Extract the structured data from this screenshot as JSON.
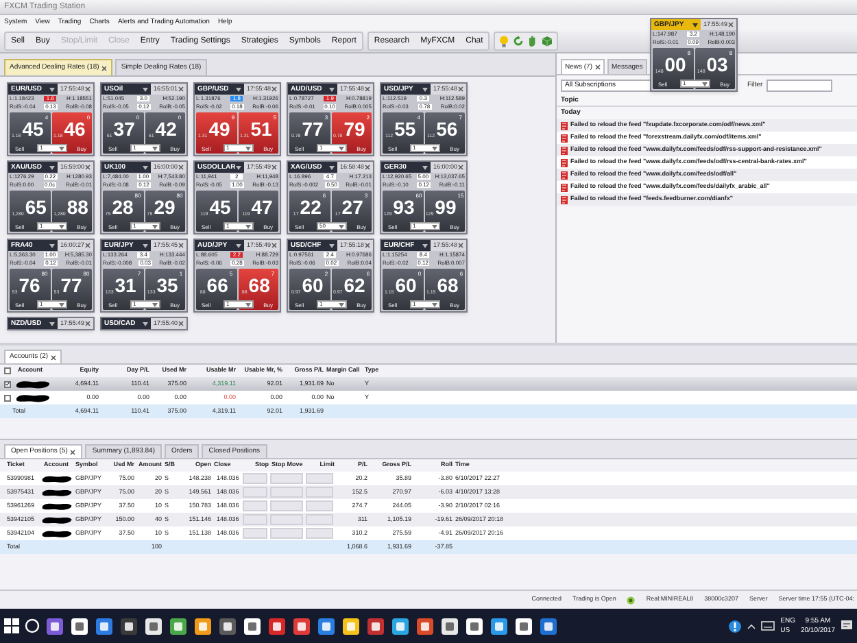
{
  "window": {
    "title": "FXCM Trading Station"
  },
  "menu": [
    "System",
    "View",
    "Trading",
    "Charts",
    "Alerts and Trading Automation",
    "Help"
  ],
  "toolbar": [
    {
      "buttons": [
        {
          "label": "Sell",
          "disabled": false
        },
        {
          "label": "Buy",
          "disabled": false
        },
        {
          "label": "Stop/Limit",
          "disabled": true
        },
        {
          "label": "Close",
          "disabled": true
        },
        {
          "label": "Entry",
          "disabled": false
        },
        {
          "label": "Trading Settings",
          "disabled": false
        },
        {
          "label": "Strategies",
          "disabled": false
        },
        {
          "label": "Symbols",
          "disabled": false
        },
        {
          "label": "Report",
          "disabled": false
        }
      ]
    },
    {
      "buttons": [
        {
          "label": "Research",
          "disabled": false
        },
        {
          "label": "MyFXCM",
          "disabled": false
        },
        {
          "label": "Chat",
          "disabled": false
        }
      ]
    }
  ],
  "dealing_tabs": [
    {
      "label": "Advanced Dealing Rates (18)",
      "selected": true
    },
    {
      "label": "Simple Dealing Rates (18)",
      "selected": false
    }
  ],
  "tiles": [
    {
      "kind": "full",
      "active": false,
      "symbol": "EUR/USD",
      "time": "17:55:48",
      "low": "L:1.18423",
      "spread": {
        "value": "1.6",
        "color": "#d8262b"
      },
      "high": "H:1.18551",
      "roll_sell": "RolS:-0.04",
      "pip_cost": "0.13",
      "roll_buy": "RolB:-0.08",
      "sell": {
        "prefix": "1.18",
        "big": "45",
        "pip": "4",
        "label": "Sell",
        "highlight": false
      },
      "buy": {
        "prefix": "1.18",
        "big": "46",
        "pip": "0",
        "label": "Buy",
        "highlight": true
      },
      "quantity": "1"
    },
    {
      "kind": "full",
      "active": false,
      "symbol": "USOil",
      "time": "16:55:01",
      "low": "L:51.045",
      "spread": "3.0",
      "high": "H:52.190",
      "roll_sell": "RolS:-0.05",
      "pip_cost": "0.12",
      "roll_buy": "RolB:-0.05",
      "sell": {
        "prefix": "51",
        "big": "37",
        "pip": "0",
        "label": "Sell",
        "highlight": false
      },
      "buy": {
        "prefix": "51",
        "big": "42",
        "pip": "0",
        "label": "Buy",
        "highlight": false
      },
      "quantity": "1"
    },
    {
      "kind": "full",
      "active": false,
      "symbol": "GBP/USD",
      "time": "17:55:48",
      "low": "L:1.31876",
      "spread": {
        "value": "1.8",
        "color": "#2a8cf0"
      },
      "high": "H:1.31926",
      "roll_sell": "RolS:-0.02",
      "pip_cost": "0.18",
      "roll_buy": "RolB:-0.06",
      "sell": {
        "prefix": "1.31",
        "big": "49",
        "pip": "9",
        "label": "Sell",
        "highlight": true
      },
      "buy": {
        "prefix": "1.31",
        "big": "51",
        "pip": "5",
        "label": "Buy",
        "highlight": true
      },
      "quantity": "1"
    },
    {
      "kind": "full",
      "active": false,
      "symbol": "AUD/USD",
      "time": "17:55:48",
      "low": "L:0.78727",
      "spread": {
        "value": "1.9",
        "color": "#d8262b"
      },
      "high": "H:0.78819",
      "roll_sell": "RolS:-0.01",
      "pip_cost": "0.10",
      "roll_buy": "RolB:0.005",
      "sell": {
        "prefix": "0.78",
        "big": "77",
        "pip": "3",
        "label": "Sell",
        "highlight": false
      },
      "buy": {
        "prefix": "0.78",
        "big": "79",
        "pip": "2",
        "label": "Buy",
        "highlight": true
      },
      "quantity": "1"
    },
    {
      "kind": "full",
      "active": false,
      "symbol": "USD/JPY",
      "time": "17:55:48",
      "low": "L:112.519",
      "spread": "0.3",
      "high": "H:112.589",
      "roll_sell": "RolS:-0.03",
      "pip_cost": "0.78",
      "roll_buy": "RolB:0.02",
      "sell": {
        "prefix": "112",
        "big": "55",
        "pip": "4",
        "label": "Sell",
        "highlight": false
      },
      "buy": {
        "prefix": "112",
        "big": "56",
        "pip": "7",
        "label": "Buy",
        "highlight": false
      },
      "quantity": "1"
    },
    {
      "kind": "full",
      "active": false,
      "symbol": "XAU/USD",
      "time": "16:59:00",
      "low": "L:1276.29",
      "spread": "0.22",
      "high": "H:1280.93",
      "roll_sell": "RolS:0.00",
      "pip_cost": "0.0c",
      "roll_buy": "RolB:-0.01",
      "sell": {
        "prefix": "1,280",
        "big": "65",
        "label": "Sell",
        "highlight": false
      },
      "buy": {
        "prefix": "1,280",
        "big": "88",
        "label": "Buy",
        "highlight": false
      },
      "quantity": "1"
    },
    {
      "kind": "full",
      "active": false,
      "symbol": "UK100",
      "time": "16:00:00",
      "low": "L:7,484.00",
      "spread": "1.00",
      "high": "H:7,543.80",
      "roll_sell": "RolS:-0.08",
      "pip_cost": "0.12",
      "roll_buy": "RolB:-0.09",
      "sell": {
        "prefix": "75",
        "big": "28",
        "pip": "80",
        "label": "Sell",
        "highlight": false
      },
      "buy": {
        "prefix": "75",
        "big": "29",
        "pip": "80",
        "label": "Buy",
        "highlight": false
      },
      "quantity": "1"
    },
    {
      "kind": "full",
      "active": false,
      "symbol": "USDOLLAR",
      "time": "17:55:49",
      "low": "L:11,941",
      "spread": "2",
      "high": "H:11,948",
      "roll_sell": "RolS:-0.05",
      "pip_cost": "1.00",
      "roll_buy": "RolB:-0.13",
      "sell": {
        "prefix": "119",
        "big": "45",
        "label": "Sell",
        "highlight": false
      },
      "buy": {
        "prefix": "119",
        "big": "47",
        "label": "Buy",
        "highlight": false
      },
      "quantity": "1"
    },
    {
      "kind": "full",
      "active": false,
      "symbol": "XAG/USD",
      "time": "16:58:48",
      "low": "L:16.896",
      "spread": "4.7",
      "high": "H:17.213",
      "roll_sell": "RolS:-0.002",
      "pip_cost": "0.50",
      "roll_buy": "RolB:-0.01",
      "sell": {
        "prefix": "17",
        "big": "22",
        "pip": "6",
        "label": "Sell",
        "highlight": false
      },
      "buy": {
        "prefix": "17",
        "big": "27",
        "pip": "3",
        "label": "Buy",
        "highlight": false
      },
      "quantity": "50"
    },
    {
      "kind": "full",
      "active": false,
      "symbol": "GER30",
      "time": "16:00:00",
      "low": "L:12,920.65",
      "spread": "5.00",
      "high": "H:13,037.65",
      "roll_sell": "RolS:-0.10",
      "pip_cost": "0.12",
      "roll_buy": "RolB:-0.11",
      "sell": {
        "prefix": "129",
        "big": "93",
        "pip": "60",
        "label": "Sell",
        "highlight": false
      },
      "buy": {
        "prefix": "129",
        "big": "99",
        "pip": "15",
        "label": "Buy",
        "highlight": false
      },
      "quantity": "1"
    },
    {
      "kind": "full",
      "active": false,
      "symbol": "FRA40",
      "time": "16:00:27",
      "low": "L:5,363.30",
      "spread": "1.00",
      "high": "H:5,385.30",
      "roll_sell": "RolS:-0.04",
      "pip_cost": "0.12",
      "roll_buy": "RolB:-0.01",
      "sell": {
        "prefix": "53",
        "big": "76",
        "pip": "80",
        "label": "Sell",
        "highlight": false
      },
      "buy": {
        "prefix": "53",
        "big": "77",
        "pip": "80",
        "label": "Buy",
        "highlight": false
      },
      "quantity": "1"
    },
    {
      "kind": "full",
      "active": false,
      "symbol": "EUR/JPY",
      "time": "17:55:45",
      "low": "L:133.264",
      "spread": "3.4",
      "high": "H:133.444",
      "roll_sell": "RolS:-0.008",
      "pip_cost": "0.03",
      "roll_buy": "RolB:-0.02",
      "sell": {
        "prefix": "133",
        "big": "31",
        "pip": "7",
        "label": "Sell",
        "highlight": false
      },
      "buy": {
        "prefix": "133",
        "big": "35",
        "pip": "1",
        "label": "Buy",
        "highlight": false
      },
      "quantity": "1"
    },
    {
      "kind": "full",
      "active": false,
      "symbol": "AUD/JPY",
      "time": "17:55:49",
      "low": "L:88.605",
      "spread": {
        "value": "2.2",
        "color": "#d8262b"
      },
      "high": "H:88.729",
      "roll_sell": "RolS:-0.06",
      "pip_cost": "0.28",
      "roll_buy": "RolB:-0.03",
      "sell": {
        "prefix": "88",
        "big": "66",
        "pip": "5",
        "label": "Sell",
        "highlight": false
      },
      "buy": {
        "prefix": "88",
        "big": "68",
        "pip": "7",
        "label": "Buy",
        "highlight": true
      },
      "quantity": "1"
    },
    {
      "kind": "full",
      "active": false,
      "symbol": "USD/CHF",
      "time": "17:55:18",
      "low": "L:0.97561",
      "spread": "2.4",
      "high": "H:0.97686",
      "roll_sell": "RolS:-0.06",
      "pip_cost": "0.02",
      "roll_buy": "RolB:0.04",
      "sell": {
        "prefix": "0.97",
        "big": "60",
        "pip": "2",
        "label": "Sell",
        "highlight": false
      },
      "buy": {
        "prefix": "0.97",
        "big": "62",
        "pip": "6",
        "label": "Buy",
        "highlight": false
      },
      "quantity": "1"
    },
    {
      "kind": "full",
      "active": false,
      "symbol": "EUR/CHF",
      "time": "17:55:48",
      "low": "L:1.15254",
      "spread": "8.4",
      "high": "H:1.15874",
      "roll_sell": "RolS:-0.02",
      "pip_cost": "0.12",
      "roll_buy": "RolB:0.007",
      "sell": {
        "prefix": "1.15",
        "big": "60",
        "pip": "0",
        "label": "Sell",
        "highlight": false
      },
      "buy": {
        "prefix": "1.15",
        "big": "68",
        "pip": "6",
        "label": "Buy",
        "highlight": false
      },
      "quantity": "1"
    },
    {
      "kind": "cut",
      "active": false,
      "symbol": "NZD/USD",
      "time": "17:55:49"
    },
    {
      "kind": "cut",
      "active": false,
      "symbol": "USD/CAD",
      "time": "17:55:40"
    }
  ],
  "floating_tile": {
    "kind": "full",
    "active": true,
    "symbol": "GBP/JPY",
    "time": "17:55:49",
    "low": "L:147.987",
    "spread": "3.2",
    "high": "H:148.190",
    "roll_sell": "RolS:-0.01",
    "pip_cost": "0.09",
    "roll_buy": "RolB:0.003",
    "sell": {
      "prefix": "148",
      "big": "00",
      "pip": "8",
      "label": "Sell",
      "highlight": false
    },
    "buy": {
      "prefix": "148",
      "big": "03",
      "pip": "8",
      "label": "Buy",
      "highlight": false
    },
    "quantity": "1"
  },
  "news": {
    "tabs": [
      {
        "label": "News (7)",
        "selected": true
      },
      {
        "label": "Messages",
        "selected": false
      }
    ],
    "subscription": "All Subscriptions",
    "filter_label": "Filter",
    "column": "Topic",
    "group": "Today",
    "items": [
      "Failed to reload the feed \"fxupdate.fxcorporate.com/odf/news.xml\"",
      "Failed to reload the feed \"forexstream.dailyfx.com/odf/items.xml\"",
      "Failed to reload the feed \"www.dailyfx.com/feeds/odf/rss-support-and-resistance.xml\"",
      "Failed to reload the feed \"www.dailyfx.com/feeds/odf/rss-central-bank-rates.xml\"",
      "Failed to reload the feed \"www.dailyfx.com/feeds/odf/all\"",
      "Failed to reload the feed \"www.dailyfx.com/feeds/dailyfx_arabic_all\"",
      "Failed to reload the feed \"feeds.feedburner.com/dianfx\""
    ]
  },
  "accounts": {
    "tab": "Accounts (2)",
    "header_checked": false,
    "columns": [
      "Account",
      "Equity",
      "Day P/L",
      "Used Mr",
      "Usable Mr",
      "Usable Mr, %",
      "Gross P/L",
      "Margin Call",
      "Type"
    ],
    "rows": [
      {
        "checked": true,
        "selected": true,
        "account_redacted": true,
        "cells": [
          "",
          "4,694.11",
          "110.41",
          "375.00",
          {
            "text": "4,319.11",
            "negative": false
          },
          "92.01",
          "1,931.69",
          "No",
          "Y"
        ]
      },
      {
        "checked": false,
        "selected": false,
        "account_redacted": true,
        "cells": [
          "",
          "0.00",
          "0.00",
          "0.00",
          {
            "text": "0.00",
            "negative": true
          },
          "0.00",
          "0.00",
          "No",
          "Y"
        ]
      }
    ],
    "total": {
      "cells": [
        "Total",
        "4,694.11",
        "110.41",
        "375.00",
        "4,319.11",
        "92.01",
        "1,931.69"
      ]
    }
  },
  "positions": {
    "tabs": [
      {
        "label": "Open Positions (5)",
        "selected": true
      },
      {
        "label": "Summary (1,893.84)",
        "selected": false
      },
      {
        "label": "Orders",
        "selected": false
      },
      {
        "label": "Closed Positions",
        "selected": false
      }
    ],
    "columns": [
      "Ticket",
      "Account",
      "Symbol",
      "Usd Mr",
      "Amount",
      "S/B",
      "Open",
      "Close",
      "Stop",
      "Stop Move",
      "Limit",
      "P/L",
      "Gross P/L",
      "Roll",
      "Time"
    ],
    "rows": [
      {
        "ticket": "53990981",
        "account_redacted": true,
        "symbol": "GBP/JPY",
        "usd_mr": "75.00",
        "amount": "20",
        "side": "S",
        "open": "148.238",
        "close": "148.036",
        "pl": "20.2",
        "gross_pl": "35.89",
        "roll": "-3.80",
        "time": "6/10/2017 22:27"
      },
      {
        "ticket": "53975431",
        "account_redacted": true,
        "symbol": "GBP/JPY",
        "usd_mr": "75.00",
        "amount": "20",
        "side": "S",
        "open": "149.561",
        "close": "148.036",
        "pl": "152.5",
        "gross_pl": "270.97",
        "roll": "-6.03",
        "time": "4/10/2017 13:28"
      },
      {
        "ticket": "53961269",
        "account_redacted": true,
        "symbol": "GBP/JPY",
        "usd_mr": "37.50",
        "amount": "10",
        "side": "S",
        "open": "150.783",
        "close": "148.036",
        "pl": "274.7",
        "gross_pl": "244.05",
        "roll": "-3.90",
        "time": "2/10/2017 02:16"
      },
      {
        "ticket": "53942105",
        "account_redacted": true,
        "symbol": "GBP/JPY",
        "usd_mr": "150.00",
        "amount": "40",
        "side": "S",
        "open": "151.146",
        "close": "148.036",
        "pl": "311",
        "gross_pl": "1,105.19",
        "roll": "-19.61",
        "time": "26/09/2017 20:18"
      },
      {
        "ticket": "53942104",
        "account_redacted": true,
        "symbol": "GBP/JPY",
        "usd_mr": "37.50",
        "amount": "10",
        "side": "S",
        "open": "151.138",
        "close": "148.036",
        "pl": "310.2",
        "gross_pl": "275.59",
        "roll": "-4.91",
        "time": "26/09/2017 20:16"
      }
    ],
    "total": {
      "label": "Total",
      "amount": "100",
      "pl": "1,068.6",
      "gross_pl": "1,931.69",
      "roll": "-37.85"
    }
  },
  "status_bar": {
    "connection": "Connected",
    "trading": "Trading is Open",
    "account": "Real:MINIREAL8",
    "account_id": "38000c3207",
    "server": "Server",
    "server_time": "Server time 17:55 (UTC-04:"
  },
  "taskbar": {
    "language": "ENG",
    "region": "US",
    "time": "9:55 AM",
    "date": "20/10/2017"
  }
}
